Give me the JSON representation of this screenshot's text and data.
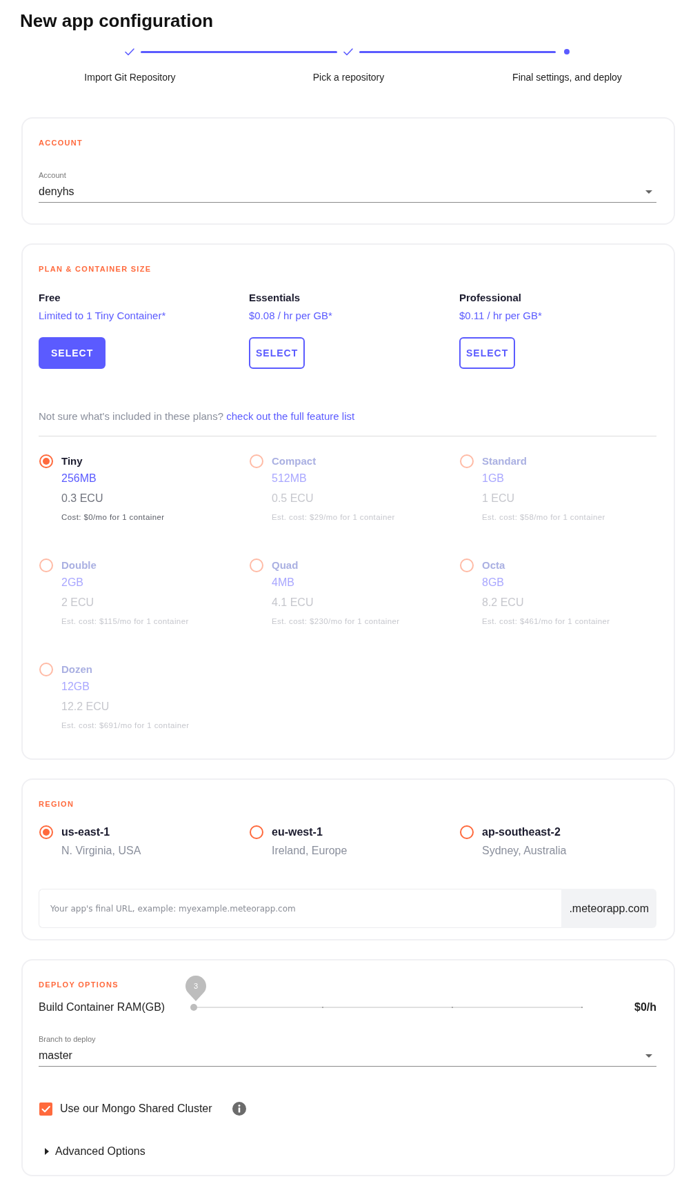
{
  "page": {
    "title": "New app configuration"
  },
  "stepper": {
    "steps": [
      {
        "label": "Import Git Repository",
        "completed": true,
        "active": false
      },
      {
        "label": "Pick a repository",
        "completed": true,
        "active": false
      },
      {
        "label": "Final settings, and deploy",
        "completed": false,
        "active": true
      }
    ]
  },
  "account": {
    "heading": "ACCOUNT",
    "field": {
      "label": "Account",
      "value": "denyhs"
    }
  },
  "plan": {
    "heading": "PLAN & CONTAINER SIZE",
    "plans": [
      {
        "name": "Free",
        "price": "Limited to 1 Tiny Container*",
        "button": "SELECT",
        "selected": true
      },
      {
        "name": "Essentials",
        "price": "$0.08 / hr per GB*",
        "button": "SELECT",
        "selected": false
      },
      {
        "name": "Professional",
        "price": "$0.11 / hr per GB*",
        "button": "SELECT",
        "selected": false
      }
    ],
    "note": {
      "text": "Not sure what's included in these plans?",
      "link": "check out the full feature list"
    },
    "sizes": [
      {
        "name": "Tiny",
        "memory": "256MB",
        "ecu": "0.3 ECU",
        "cost": "Cost: $0/mo for 1 container",
        "selected": true,
        "disabled": false
      },
      {
        "name": "Compact",
        "memory": "512MB",
        "ecu": "0.5 ECU",
        "cost": "Est. cost: $29/mo for 1 container",
        "selected": false,
        "disabled": true
      },
      {
        "name": "Standard",
        "memory": "1GB",
        "ecu": "1 ECU",
        "cost": "Est. cost: $58/mo for 1 container",
        "selected": false,
        "disabled": true
      },
      {
        "name": "Double",
        "memory": "2GB",
        "ecu": "2 ECU",
        "cost": "Est. cost: $115/mo for 1 container",
        "selected": false,
        "disabled": true
      },
      {
        "name": "Quad",
        "memory": "4MB",
        "ecu": "4.1 ECU",
        "cost": "Est. cost: $230/mo for 1 container",
        "selected": false,
        "disabled": true
      },
      {
        "name": "Octa",
        "memory": "8GB",
        "ecu": "8.2 ECU",
        "cost": "Est. cost: $461/mo for 1 container",
        "selected": false,
        "disabled": true
      },
      {
        "name": "Dozen",
        "memory": "12GB",
        "ecu": "12.2 ECU",
        "cost": "Est. cost: $691/mo for 1 container",
        "selected": false,
        "disabled": true
      }
    ]
  },
  "region": {
    "heading": "REGION",
    "regions": [
      {
        "name": "us-east-1",
        "location": "N. Virginia, USA",
        "selected": true
      },
      {
        "name": "eu-west-1",
        "location": "Ireland, Europe",
        "selected": false
      },
      {
        "name": "ap-southeast-2",
        "location": "Sydney, Australia",
        "selected": false
      }
    ],
    "url_field": {
      "placeholder": "Your app's final URL, example: myexample.meteorapp.com",
      "suffix": ".meteorapp.com"
    }
  },
  "deploy": {
    "heading": "DEPLOY OPTIONS",
    "ram": {
      "label": "Build Container RAM(GB)",
      "tooltip": "3",
      "level": 0,
      "price": "$0/h"
    },
    "branch": {
      "label": "Branch to deploy",
      "value": "master"
    },
    "mongo": {
      "label": "Use our Mongo Shared Cluster",
      "checked": true
    },
    "advanced": {
      "label": "Advanced Options",
      "expanded": false
    }
  }
}
